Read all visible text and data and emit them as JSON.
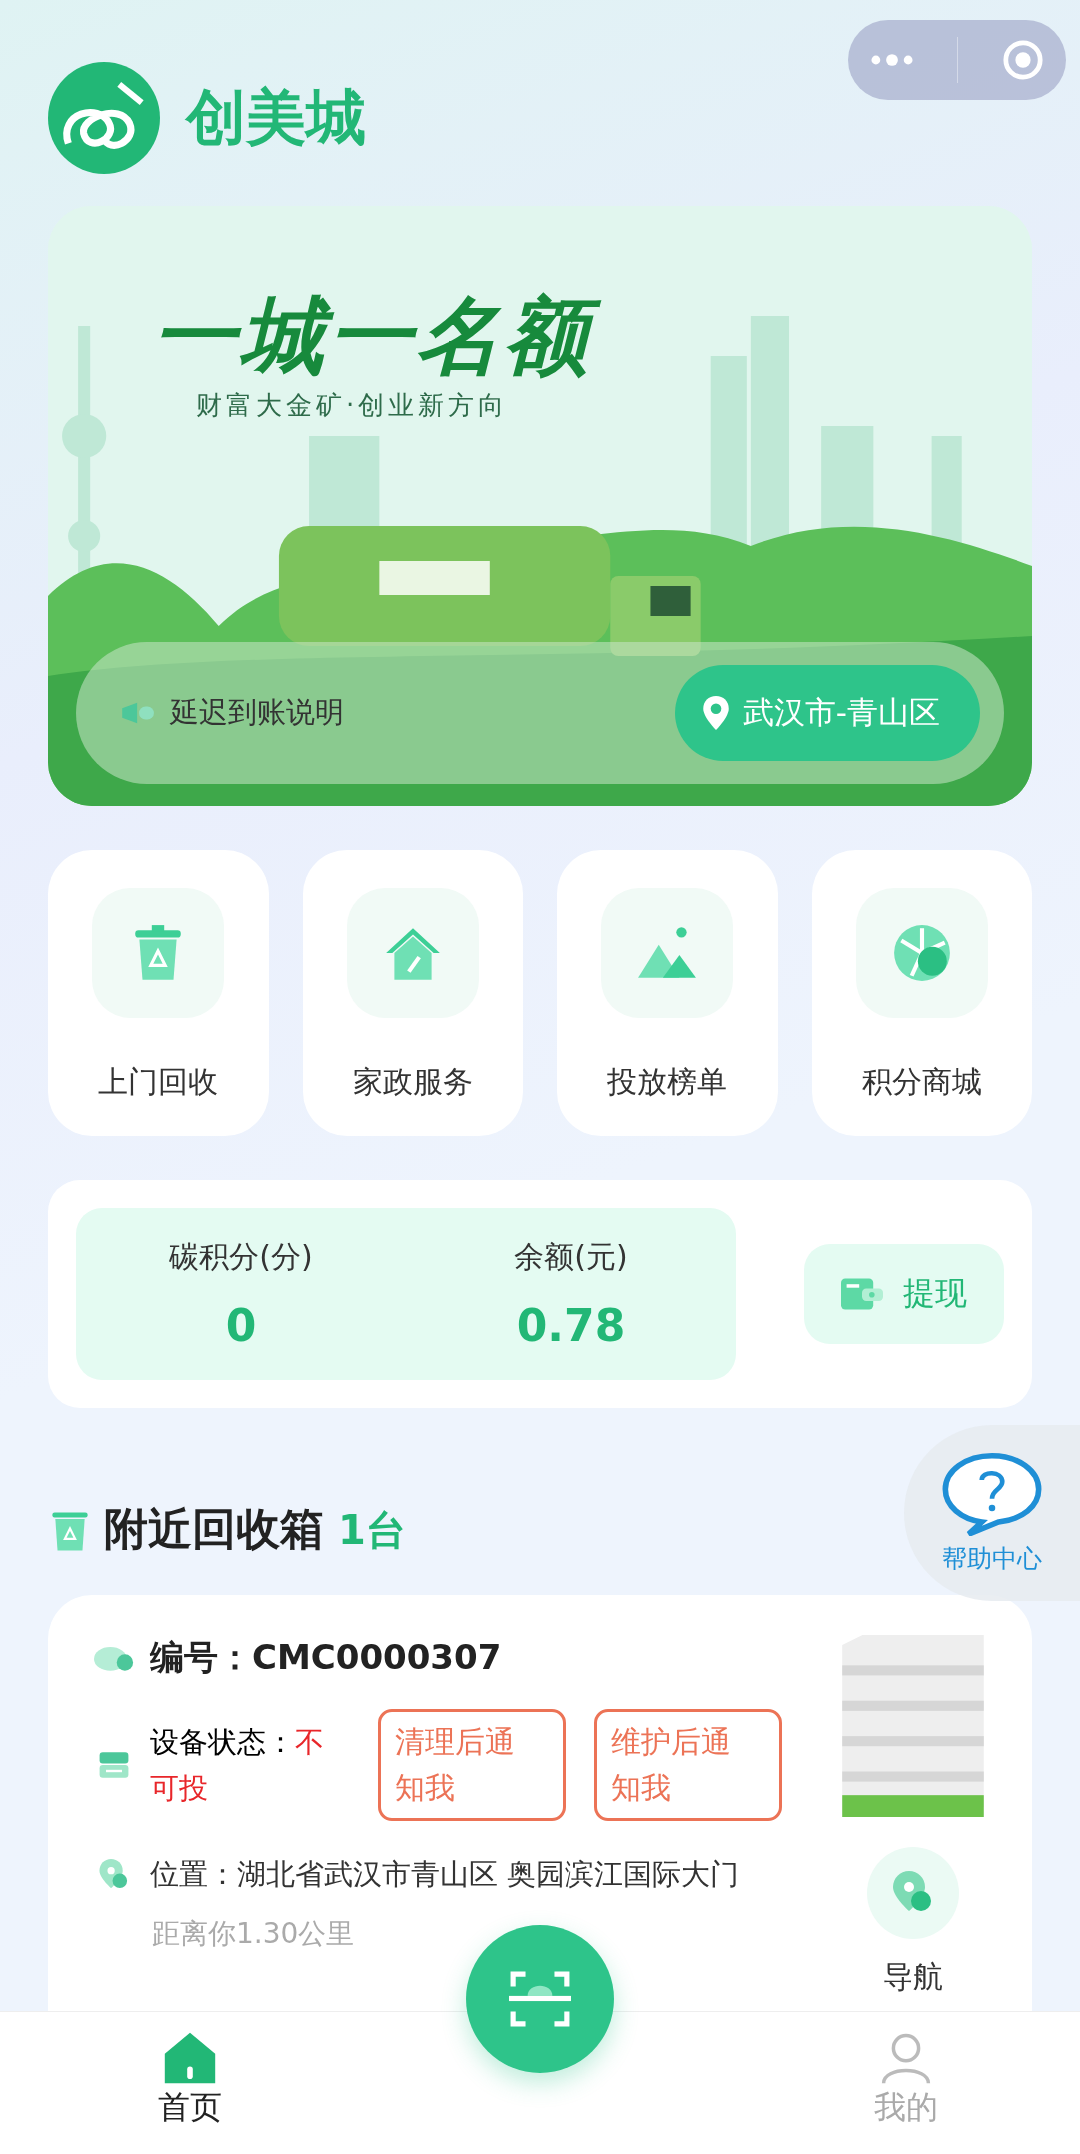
{
  "header": {
    "app_name": "创美城"
  },
  "banner": {
    "title": "一城一名额",
    "subtitle": "财富大金矿·创业新方向",
    "notice": "延迟到账说明",
    "location": "武汉市-青山区"
  },
  "services": [
    {
      "label": "上门回收"
    },
    {
      "label": "家政服务"
    },
    {
      "label": "投放榜单"
    },
    {
      "label": "积分商城"
    }
  ],
  "stats": [
    {
      "label": "碳积分(分)",
      "value": "0"
    },
    {
      "label": "余额(元)",
      "value": "0.78"
    }
  ],
  "withdraw": "提现",
  "help": "帮助中心",
  "nearby": {
    "title": "附近回收箱",
    "count": "1台",
    "boxes": [
      {
        "code": "编号：CMC0000307",
        "status_label": "设备状态：",
        "status": "不可投",
        "available": false,
        "actions": [
          "清理后通知我",
          "维护后通知我"
        ],
        "location": "位置：湖北省武汉市青山区 奥园滨江国际大门",
        "distance": "距离你1.30公里",
        "level": 0.12,
        "nav": "导航"
      }
    ]
  },
  "tabbar": [
    {
      "label": "首页",
      "selected": true
    },
    {
      "label": "我的",
      "selected": false
    }
  ]
}
